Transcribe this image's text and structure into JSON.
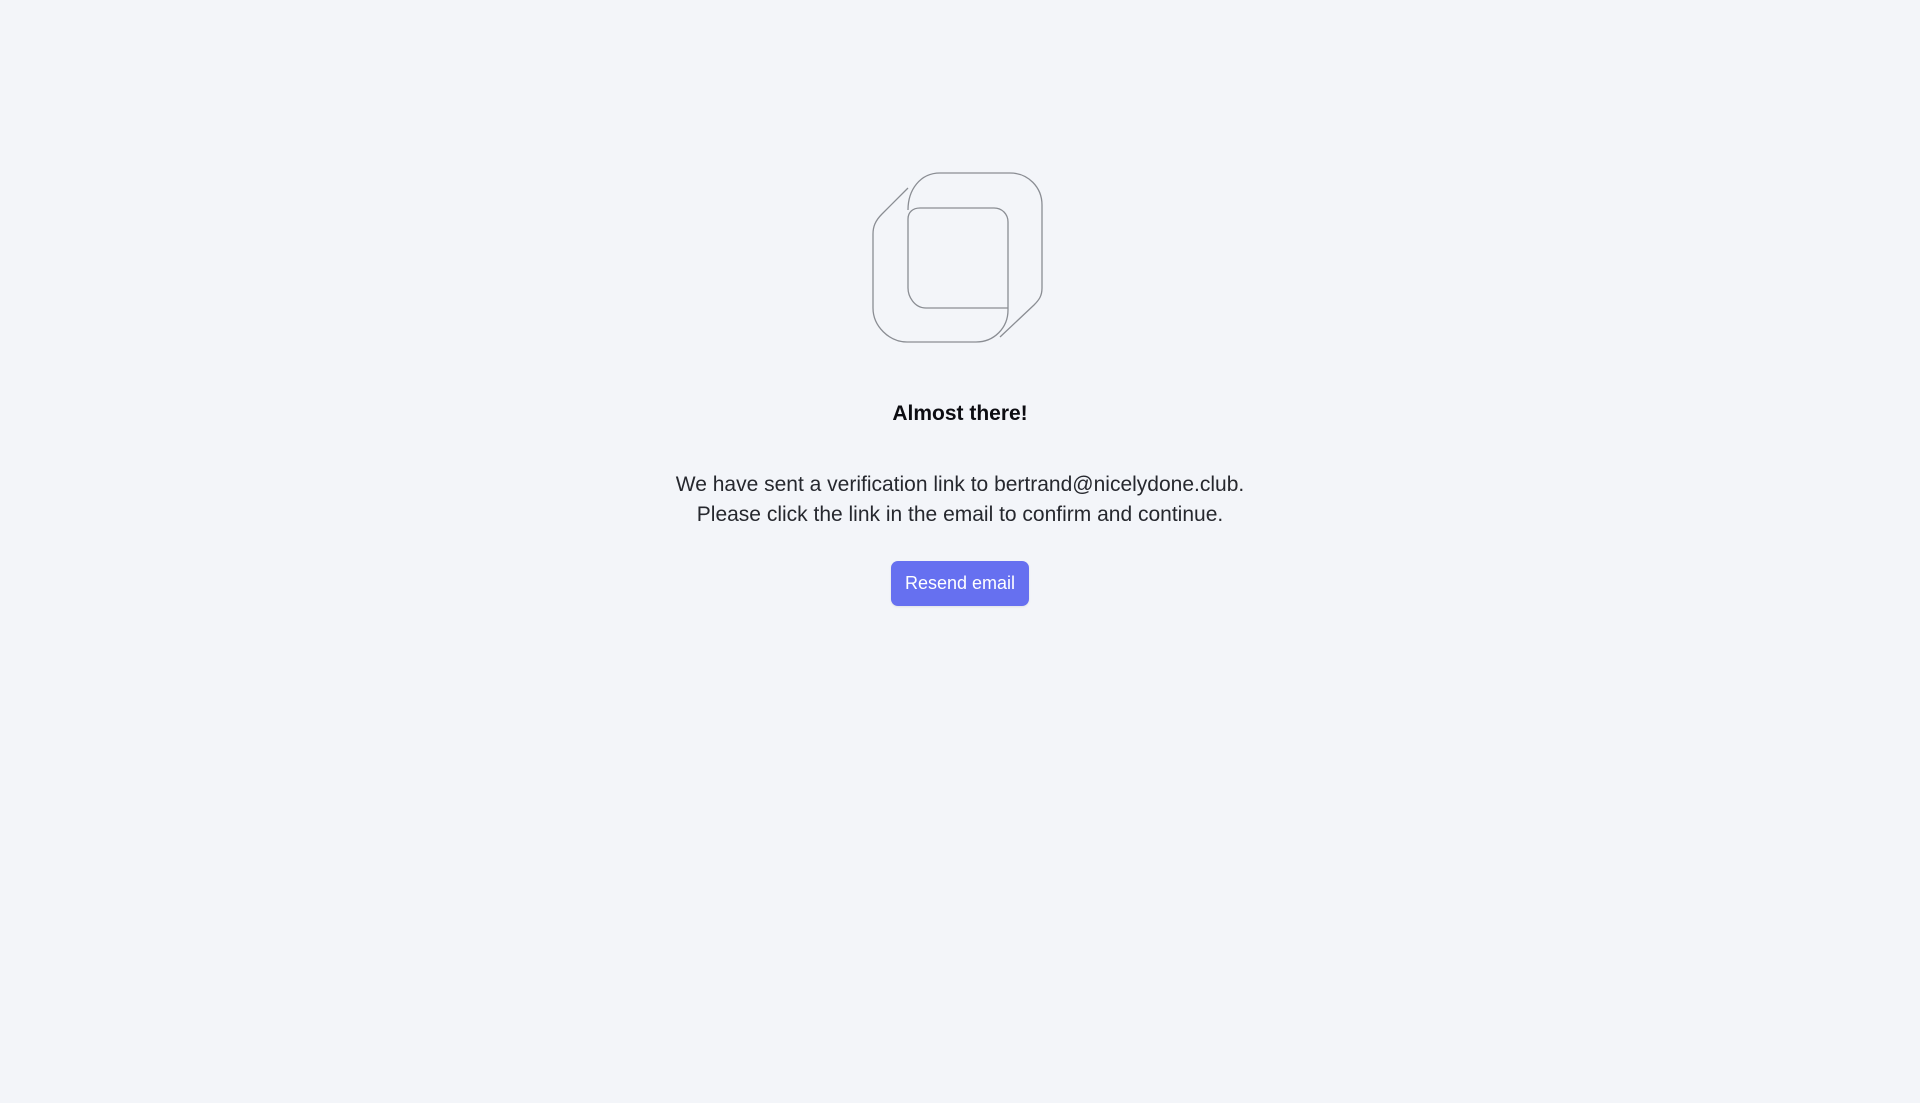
{
  "logo": {
    "icon": "folded-squares-logo-icon",
    "stroke_color": "#8a8d93"
  },
  "heading": {
    "title": "Almost there!"
  },
  "message": {
    "line1": "We have sent a verification link to bertrand@nicelydone.club.",
    "line2": "Please click the link in the email to confirm and continue."
  },
  "actions": {
    "resend_label": "Resend email",
    "button_color": "#6670f0"
  }
}
